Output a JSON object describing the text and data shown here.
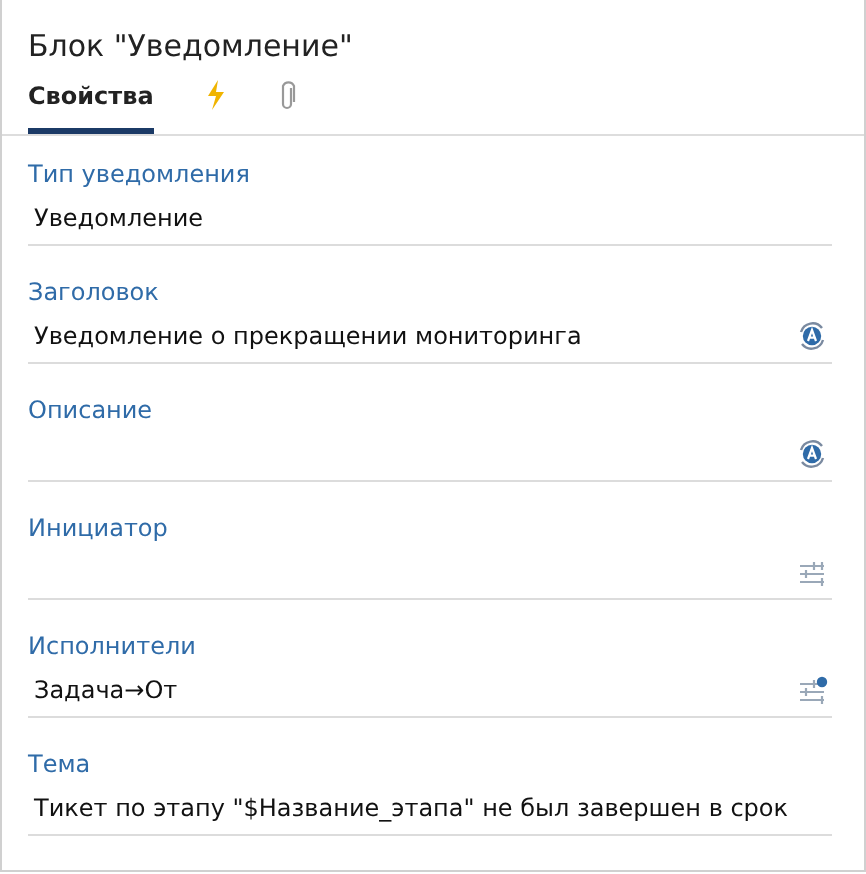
{
  "title": "Блок \"Уведомление\"",
  "tabs": [
    {
      "kind": "text",
      "label": "Свойства",
      "selected": true
    },
    {
      "kind": "lightning",
      "selected": false
    },
    {
      "kind": "paperclip",
      "selected": false
    }
  ],
  "fields": [
    {
      "kind": "plain",
      "label": "Тип уведомления",
      "value": "Уведомление"
    },
    {
      "kind": "localized",
      "label": "Заголовок",
      "value": "Уведомление о прекращении мониторинга"
    },
    {
      "kind": "localized",
      "label": "Описание"
    },
    {
      "kind": "mapping",
      "label": "Инициатор",
      "mapped": false
    },
    {
      "kind": "mapping",
      "label": "Исполнители",
      "value": "Задача→От",
      "mapped": true
    },
    {
      "kind": "plain",
      "label": "Тема",
      "value": "Тикет по этапу \"$Название_этапа\" не был завершен в срок"
    }
  ]
}
